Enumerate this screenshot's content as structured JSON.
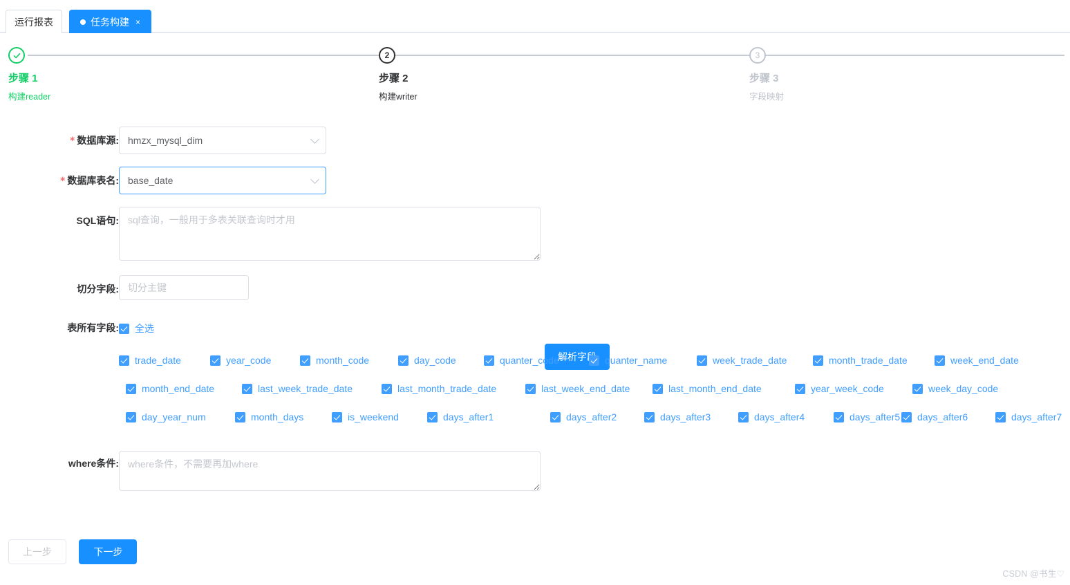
{
  "tabs": [
    {
      "label": "运行报表",
      "active": false,
      "closable": false
    },
    {
      "label": "任务构建",
      "active": true,
      "closable": true,
      "close_label": "×"
    }
  ],
  "steps": [
    {
      "index": "1",
      "title": "步骤 1",
      "desc": "构建reader",
      "state": "done",
      "icon": "check-icon"
    },
    {
      "index": "2",
      "title": "步骤 2",
      "desc": "构建writer",
      "state": "active",
      "icon": "number-2"
    },
    {
      "index": "3",
      "title": "步骤 3",
      "desc": "字段映射",
      "state": "wait",
      "icon": "number-3"
    }
  ],
  "form": {
    "datasource": {
      "label": "数据库源:",
      "required": true,
      "value": "hmzx_mysql_dim",
      "focused": false
    },
    "tablename": {
      "label": "数据库表名:",
      "required": true,
      "value": "base_date",
      "focused": true
    },
    "sql": {
      "label": "SQL语句:",
      "value": "",
      "placeholder": "sql查询，一般用于多表关联查询时才用"
    },
    "parse_button": {
      "label": "解析字段"
    },
    "split_field": {
      "label": "切分字段:",
      "value": "",
      "placeholder": "切分主键"
    },
    "all_fields": {
      "label": "表所有字段:",
      "select_all_label": "全选",
      "select_all_checked": true
    },
    "where": {
      "label": "where条件:",
      "value": "",
      "placeholder": "where条件，不需要再加where"
    }
  },
  "fields": [
    [
      "trade_date",
      "year_code",
      "month_code",
      "day_code",
      "quanter_code",
      "quanter_name",
      "week_trade_date",
      "month_trade_date",
      "week_end_date"
    ],
    [
      "month_end_date",
      "last_week_trade_date",
      "last_month_trade_date",
      "last_week_end_date",
      "last_month_end_date",
      "year_week_code",
      "week_day_code"
    ],
    [
      "day_year_num",
      "month_days",
      "is_weekend",
      "days_after1",
      "days_after2",
      "days_after3",
      "days_after4",
      "days_after5",
      "days_after6",
      "days_after7"
    ]
  ],
  "footer": {
    "prev_label": "上一步",
    "next_label": "下一步",
    "prev_disabled": true
  },
  "watermark": "CSDN @书生♡",
  "colors": {
    "primary": "#1890ff",
    "checkbox": "#409eff",
    "success": "#13ce66",
    "required": "#f56c6c",
    "muted": "#c0c4cc",
    "border": "#dcdfe6"
  }
}
